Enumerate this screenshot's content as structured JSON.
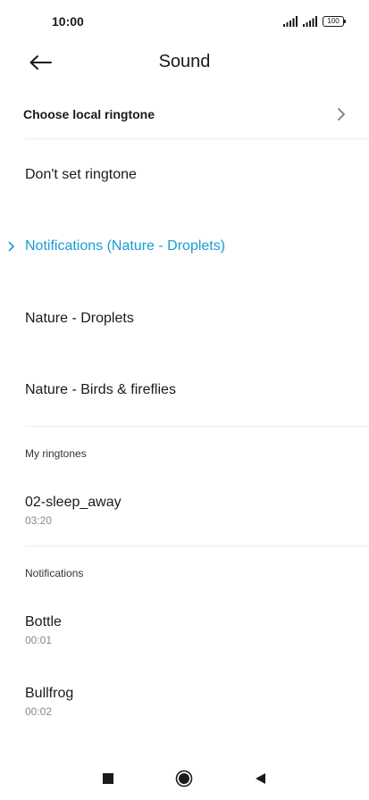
{
  "status_bar": {
    "time": "10:00",
    "battery": "100"
  },
  "header": {
    "title": "Sound"
  },
  "local_ringtone": {
    "label": "Choose local ringtone"
  },
  "items": [
    {
      "label": "Don't set ringtone"
    },
    {
      "label": "Notifications (Nature - Droplets)",
      "selected": true
    },
    {
      "label": "Nature - Droplets"
    },
    {
      "label": "Nature - Birds & fireflies"
    }
  ],
  "sections": [
    {
      "header": "My ringtones",
      "items": [
        {
          "label": "02-sleep_away",
          "duration": "03:20"
        }
      ]
    },
    {
      "header": "Notifications",
      "items": [
        {
          "label": "Bottle",
          "duration": "00:01"
        },
        {
          "label": "Bullfrog",
          "duration": "00:02"
        }
      ]
    }
  ],
  "colors": {
    "accent": "#1a9bd6",
    "text": "#1a1a1a",
    "secondary_text": "#8a8a8a",
    "divider": "#ececec"
  },
  "nav": {
    "recents_icon": "square-icon",
    "home_icon": "circle-icon",
    "back_icon": "triangle-back-icon"
  }
}
